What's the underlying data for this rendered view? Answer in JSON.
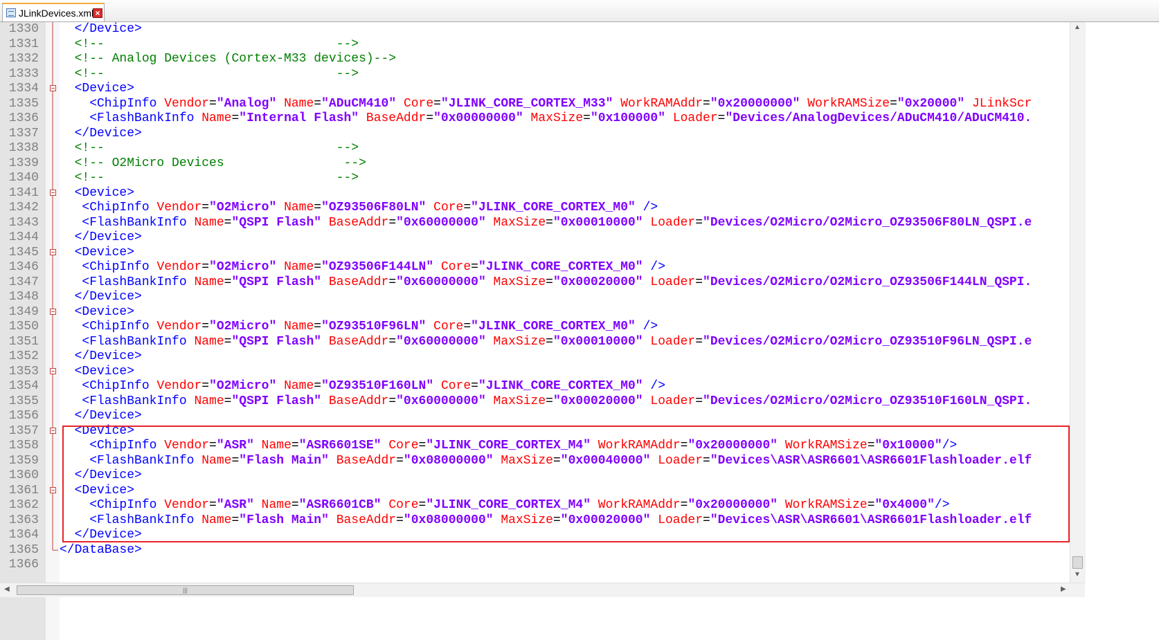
{
  "tab": {
    "label": "JLinkDevices.xml",
    "close_glyph": "×"
  },
  "lines": [
    {
      "n": "1330",
      "fold": false,
      "tokens": [
        [
          "tag",
          "  </Device>"
        ]
      ]
    },
    {
      "n": "1331",
      "fold": false,
      "tokens": [
        [
          "comment",
          "  <!--                               -->"
        ]
      ]
    },
    {
      "n": "1332",
      "fold": false,
      "tokens": [
        [
          "comment",
          "  <!-- Analog Devices (Cortex-M33 devices)-->"
        ]
      ]
    },
    {
      "n": "1333",
      "fold": false,
      "tokens": [
        [
          "comment",
          "  <!--                               -->"
        ]
      ]
    },
    {
      "n": "1334",
      "fold": true,
      "tokens": [
        [
          "tag",
          "  <Device>"
        ]
      ]
    },
    {
      "n": "1335",
      "fold": false,
      "tokens": [
        [
          "tag",
          "    <ChipInfo "
        ],
        [
          "attr",
          "Vendor"
        ],
        [
          "eq",
          "="
        ],
        [
          "val",
          "\"Analog\""
        ],
        [
          "attr",
          " Name"
        ],
        [
          "eq",
          "="
        ],
        [
          "val",
          "\"ADuCM410\""
        ],
        [
          "attr",
          " Core"
        ],
        [
          "eq",
          "="
        ],
        [
          "val",
          "\"JLINK_CORE_CORTEX_M33\""
        ],
        [
          "attr",
          " WorkRAMAddr"
        ],
        [
          "eq",
          "="
        ],
        [
          "val",
          "\"0x20000000\""
        ],
        [
          "attr",
          " WorkRAMSize"
        ],
        [
          "eq",
          "="
        ],
        [
          "val",
          "\"0x20000\""
        ],
        [
          "attr",
          " JLinkScr"
        ]
      ]
    },
    {
      "n": "1336",
      "fold": false,
      "tokens": [
        [
          "tag",
          "    <FlashBankInfo "
        ],
        [
          "attr",
          "Name"
        ],
        [
          "eq",
          "="
        ],
        [
          "val",
          "\"Internal Flash\""
        ],
        [
          "attr",
          " BaseAddr"
        ],
        [
          "eq",
          "="
        ],
        [
          "val",
          "\"0x00000000\""
        ],
        [
          "attr",
          " MaxSize"
        ],
        [
          "eq",
          "="
        ],
        [
          "val",
          "\"0x100000\""
        ],
        [
          "attr",
          " Loader"
        ],
        [
          "eq",
          "="
        ],
        [
          "val",
          "\"Devices/AnalogDevices/ADuCM410/ADuCM410."
        ]
      ]
    },
    {
      "n": "1337",
      "fold": false,
      "tokens": [
        [
          "tag",
          "  </Device>"
        ]
      ]
    },
    {
      "n": "1338",
      "fold": false,
      "tokens": [
        [
          "comment",
          "  <!--                               -->"
        ]
      ]
    },
    {
      "n": "1339",
      "fold": false,
      "tokens": [
        [
          "comment",
          "  <!-- O2Micro Devices                -->"
        ]
      ]
    },
    {
      "n": "1340",
      "fold": false,
      "tokens": [
        [
          "comment",
          "  <!--                               -->"
        ]
      ]
    },
    {
      "n": "1341",
      "fold": true,
      "tokens": [
        [
          "tag",
          "  <Device>"
        ]
      ]
    },
    {
      "n": "1342",
      "fold": false,
      "tokens": [
        [
          "tag",
          "   <ChipInfo "
        ],
        [
          "attr",
          "Vendor"
        ],
        [
          "eq",
          "="
        ],
        [
          "val",
          "\"O2Micro\""
        ],
        [
          "attr",
          " Name"
        ],
        [
          "eq",
          "="
        ],
        [
          "val",
          "\"OZ93506F80LN\""
        ],
        [
          "attr",
          " Core"
        ],
        [
          "eq",
          "="
        ],
        [
          "val",
          "\"JLINK_CORE_CORTEX_M0\""
        ],
        [
          "tag",
          " />"
        ]
      ]
    },
    {
      "n": "1343",
      "fold": false,
      "tokens": [
        [
          "tag",
          "   <FlashBankInfo "
        ],
        [
          "attr",
          "Name"
        ],
        [
          "eq",
          "="
        ],
        [
          "val",
          "\"QSPI Flash\""
        ],
        [
          "attr",
          " BaseAddr"
        ],
        [
          "eq",
          "="
        ],
        [
          "val",
          "\"0x60000000\""
        ],
        [
          "attr",
          " MaxSize"
        ],
        [
          "eq",
          "="
        ],
        [
          "val",
          "\"0x00010000\""
        ],
        [
          "attr",
          " Loader"
        ],
        [
          "eq",
          "="
        ],
        [
          "val",
          "\"Devices/O2Micro/O2Micro_OZ93506F80LN_QSPI.e"
        ]
      ]
    },
    {
      "n": "1344",
      "fold": false,
      "tokens": [
        [
          "tag",
          "  </Device>"
        ]
      ]
    },
    {
      "n": "1345",
      "fold": true,
      "tokens": [
        [
          "tag",
          "  <Device>"
        ]
      ]
    },
    {
      "n": "1346",
      "fold": false,
      "tokens": [
        [
          "tag",
          "   <ChipInfo "
        ],
        [
          "attr",
          "Vendor"
        ],
        [
          "eq",
          "="
        ],
        [
          "val",
          "\"O2Micro\""
        ],
        [
          "attr",
          " Name"
        ],
        [
          "eq",
          "="
        ],
        [
          "val",
          "\"OZ93506F144LN\""
        ],
        [
          "attr",
          " Core"
        ],
        [
          "eq",
          "="
        ],
        [
          "val",
          "\"JLINK_CORE_CORTEX_M0\""
        ],
        [
          "tag",
          " />"
        ]
      ]
    },
    {
      "n": "1347",
      "fold": false,
      "tokens": [
        [
          "tag",
          "   <FlashBankInfo "
        ],
        [
          "attr",
          "Name"
        ],
        [
          "eq",
          "="
        ],
        [
          "val",
          "\"QSPI Flash\""
        ],
        [
          "attr",
          " BaseAddr"
        ],
        [
          "eq",
          "="
        ],
        [
          "val",
          "\"0x60000000\""
        ],
        [
          "attr",
          " MaxSize"
        ],
        [
          "eq",
          "="
        ],
        [
          "val",
          "\"0x00020000\""
        ],
        [
          "attr",
          " Loader"
        ],
        [
          "eq",
          "="
        ],
        [
          "val",
          "\"Devices/O2Micro/O2Micro_OZ93506F144LN_QSPI."
        ]
      ]
    },
    {
      "n": "1348",
      "fold": false,
      "tokens": [
        [
          "tag",
          "  </Device>"
        ]
      ]
    },
    {
      "n": "1349",
      "fold": true,
      "tokens": [
        [
          "tag",
          "  <Device>"
        ]
      ]
    },
    {
      "n": "1350",
      "fold": false,
      "tokens": [
        [
          "tag",
          "   <ChipInfo "
        ],
        [
          "attr",
          "Vendor"
        ],
        [
          "eq",
          "="
        ],
        [
          "val",
          "\"O2Micro\""
        ],
        [
          "attr",
          " Name"
        ],
        [
          "eq",
          "="
        ],
        [
          "val",
          "\"OZ93510F96LN\""
        ],
        [
          "attr",
          " Core"
        ],
        [
          "eq",
          "="
        ],
        [
          "val",
          "\"JLINK_CORE_CORTEX_M0\""
        ],
        [
          "tag",
          " />"
        ]
      ]
    },
    {
      "n": "1351",
      "fold": false,
      "tokens": [
        [
          "tag",
          "   <FlashBankInfo "
        ],
        [
          "attr",
          "Name"
        ],
        [
          "eq",
          "="
        ],
        [
          "val",
          "\"QSPI Flash\""
        ],
        [
          "attr",
          " BaseAddr"
        ],
        [
          "eq",
          "="
        ],
        [
          "val",
          "\"0x60000000\""
        ],
        [
          "attr",
          " MaxSize"
        ],
        [
          "eq",
          "="
        ],
        [
          "val",
          "\"0x00010000\""
        ],
        [
          "attr",
          " Loader"
        ],
        [
          "eq",
          "="
        ],
        [
          "val",
          "\"Devices/O2Micro/O2Micro_OZ93510F96LN_QSPI.e"
        ]
      ]
    },
    {
      "n": "1352",
      "fold": false,
      "tokens": [
        [
          "tag",
          "  </Device>"
        ]
      ]
    },
    {
      "n": "1353",
      "fold": true,
      "tokens": [
        [
          "tag",
          "  <Device>"
        ]
      ]
    },
    {
      "n": "1354",
      "fold": false,
      "tokens": [
        [
          "tag",
          "   <ChipInfo "
        ],
        [
          "attr",
          "Vendor"
        ],
        [
          "eq",
          "="
        ],
        [
          "val",
          "\"O2Micro\""
        ],
        [
          "attr",
          " Name"
        ],
        [
          "eq",
          "="
        ],
        [
          "val",
          "\"OZ93510F160LN\""
        ],
        [
          "attr",
          " Core"
        ],
        [
          "eq",
          "="
        ],
        [
          "val",
          "\"JLINK_CORE_CORTEX_M0\""
        ],
        [
          "tag",
          " />"
        ]
      ]
    },
    {
      "n": "1355",
      "fold": false,
      "tokens": [
        [
          "tag",
          "   <FlashBankInfo "
        ],
        [
          "attr",
          "Name"
        ],
        [
          "eq",
          "="
        ],
        [
          "val",
          "\"QSPI Flash\""
        ],
        [
          "attr",
          " BaseAddr"
        ],
        [
          "eq",
          "="
        ],
        [
          "val",
          "\"0x60000000\""
        ],
        [
          "attr",
          " MaxSize"
        ],
        [
          "eq",
          "="
        ],
        [
          "val",
          "\"0x00020000\""
        ],
        [
          "attr",
          " Loader"
        ],
        [
          "eq",
          "="
        ],
        [
          "val",
          "\"Devices/O2Micro/O2Micro_OZ93510F160LN_QSPI."
        ]
      ]
    },
    {
      "n": "1356",
      "fold": false,
      "tokens": [
        [
          "tag",
          "  </Device>"
        ]
      ]
    },
    {
      "n": "1357",
      "fold": true,
      "tokens": [
        [
          "tag",
          "  <Device>"
        ]
      ]
    },
    {
      "n": "1358",
      "fold": false,
      "tokens": [
        [
          "tag",
          "    <ChipInfo "
        ],
        [
          "attr",
          "Vendor"
        ],
        [
          "eq",
          "="
        ],
        [
          "val",
          "\"ASR\""
        ],
        [
          "attr",
          " Name"
        ],
        [
          "eq",
          "="
        ],
        [
          "val",
          "\"ASR6601SE\""
        ],
        [
          "attr",
          " Core"
        ],
        [
          "eq",
          "="
        ],
        [
          "val",
          "\"JLINK_CORE_CORTEX_M4\""
        ],
        [
          "attr",
          " WorkRAMAddr"
        ],
        [
          "eq",
          "="
        ],
        [
          "val",
          "\"0x20000000\""
        ],
        [
          "attr",
          " WorkRAMSize"
        ],
        [
          "eq",
          "="
        ],
        [
          "val",
          "\"0x10000\""
        ],
        [
          "tag",
          "/>"
        ]
      ]
    },
    {
      "n": "1359",
      "fold": false,
      "tokens": [
        [
          "tag",
          "    <FlashBankInfo "
        ],
        [
          "attr",
          "Name"
        ],
        [
          "eq",
          "="
        ],
        [
          "val",
          "\"Flash Main\""
        ],
        [
          "attr",
          " BaseAddr"
        ],
        [
          "eq",
          "="
        ],
        [
          "val",
          "\"0x08000000\""
        ],
        [
          "attr",
          " MaxSize"
        ],
        [
          "eq",
          "="
        ],
        [
          "val",
          "\"0x00040000\""
        ],
        [
          "attr",
          " Loader"
        ],
        [
          "eq",
          "="
        ],
        [
          "val",
          "\"Devices\\ASR\\ASR6601\\ASR6601Flashloader.elf"
        ]
      ]
    },
    {
      "n": "1360",
      "fold": false,
      "tokens": [
        [
          "tag",
          "  </Device>"
        ]
      ]
    },
    {
      "n": "1361",
      "fold": true,
      "tokens": [
        [
          "tag",
          "  <Device>"
        ]
      ]
    },
    {
      "n": "1362",
      "fold": false,
      "tokens": [
        [
          "tag",
          "    <ChipInfo "
        ],
        [
          "attr",
          "Vendor"
        ],
        [
          "eq",
          "="
        ],
        [
          "val",
          "\"ASR\""
        ],
        [
          "attr",
          " Name"
        ],
        [
          "eq",
          "="
        ],
        [
          "val",
          "\"ASR6601CB\""
        ],
        [
          "attr",
          " Core"
        ],
        [
          "eq",
          "="
        ],
        [
          "val",
          "\"JLINK_CORE_CORTEX_M4\""
        ],
        [
          "attr",
          " WorkRAMAddr"
        ],
        [
          "eq",
          "="
        ],
        [
          "val",
          "\"0x20000000\""
        ],
        [
          "attr",
          " WorkRAMSize"
        ],
        [
          "eq",
          "="
        ],
        [
          "val",
          "\"0x4000\""
        ],
        [
          "tag",
          "/>"
        ]
      ]
    },
    {
      "n": "1363",
      "fold": false,
      "tokens": [
        [
          "tag",
          "    <FlashBankInfo "
        ],
        [
          "attr",
          "Name"
        ],
        [
          "eq",
          "="
        ],
        [
          "val",
          "\"Flash Main\""
        ],
        [
          "attr",
          " BaseAddr"
        ],
        [
          "eq",
          "="
        ],
        [
          "val",
          "\"0x08000000\""
        ],
        [
          "attr",
          " MaxSize"
        ],
        [
          "eq",
          "="
        ],
        [
          "val",
          "\"0x00020000\""
        ],
        [
          "attr",
          " Loader"
        ],
        [
          "eq",
          "="
        ],
        [
          "val",
          "\"Devices\\ASR\\ASR6601\\ASR6601Flashloader.elf"
        ]
      ]
    },
    {
      "n": "1364",
      "fold": false,
      "tokens": [
        [
          "tag",
          "  </Device>"
        ]
      ]
    },
    {
      "n": "1365",
      "fold": false,
      "tokens": [
        [
          "tag",
          "</DataBase>"
        ]
      ]
    },
    {
      "n": "1366",
      "fold": false,
      "tokens": []
    }
  ],
  "colors": {
    "tag": "#0000ff",
    "attribute": "#ff0000",
    "value": "#8000ff",
    "comment": "#008000",
    "highlight": "#e8232a",
    "fold_line": "#c84040"
  },
  "icons": {
    "tab": "xml-file-icon",
    "close": "close-icon",
    "fold": "fold-minus-icon"
  }
}
